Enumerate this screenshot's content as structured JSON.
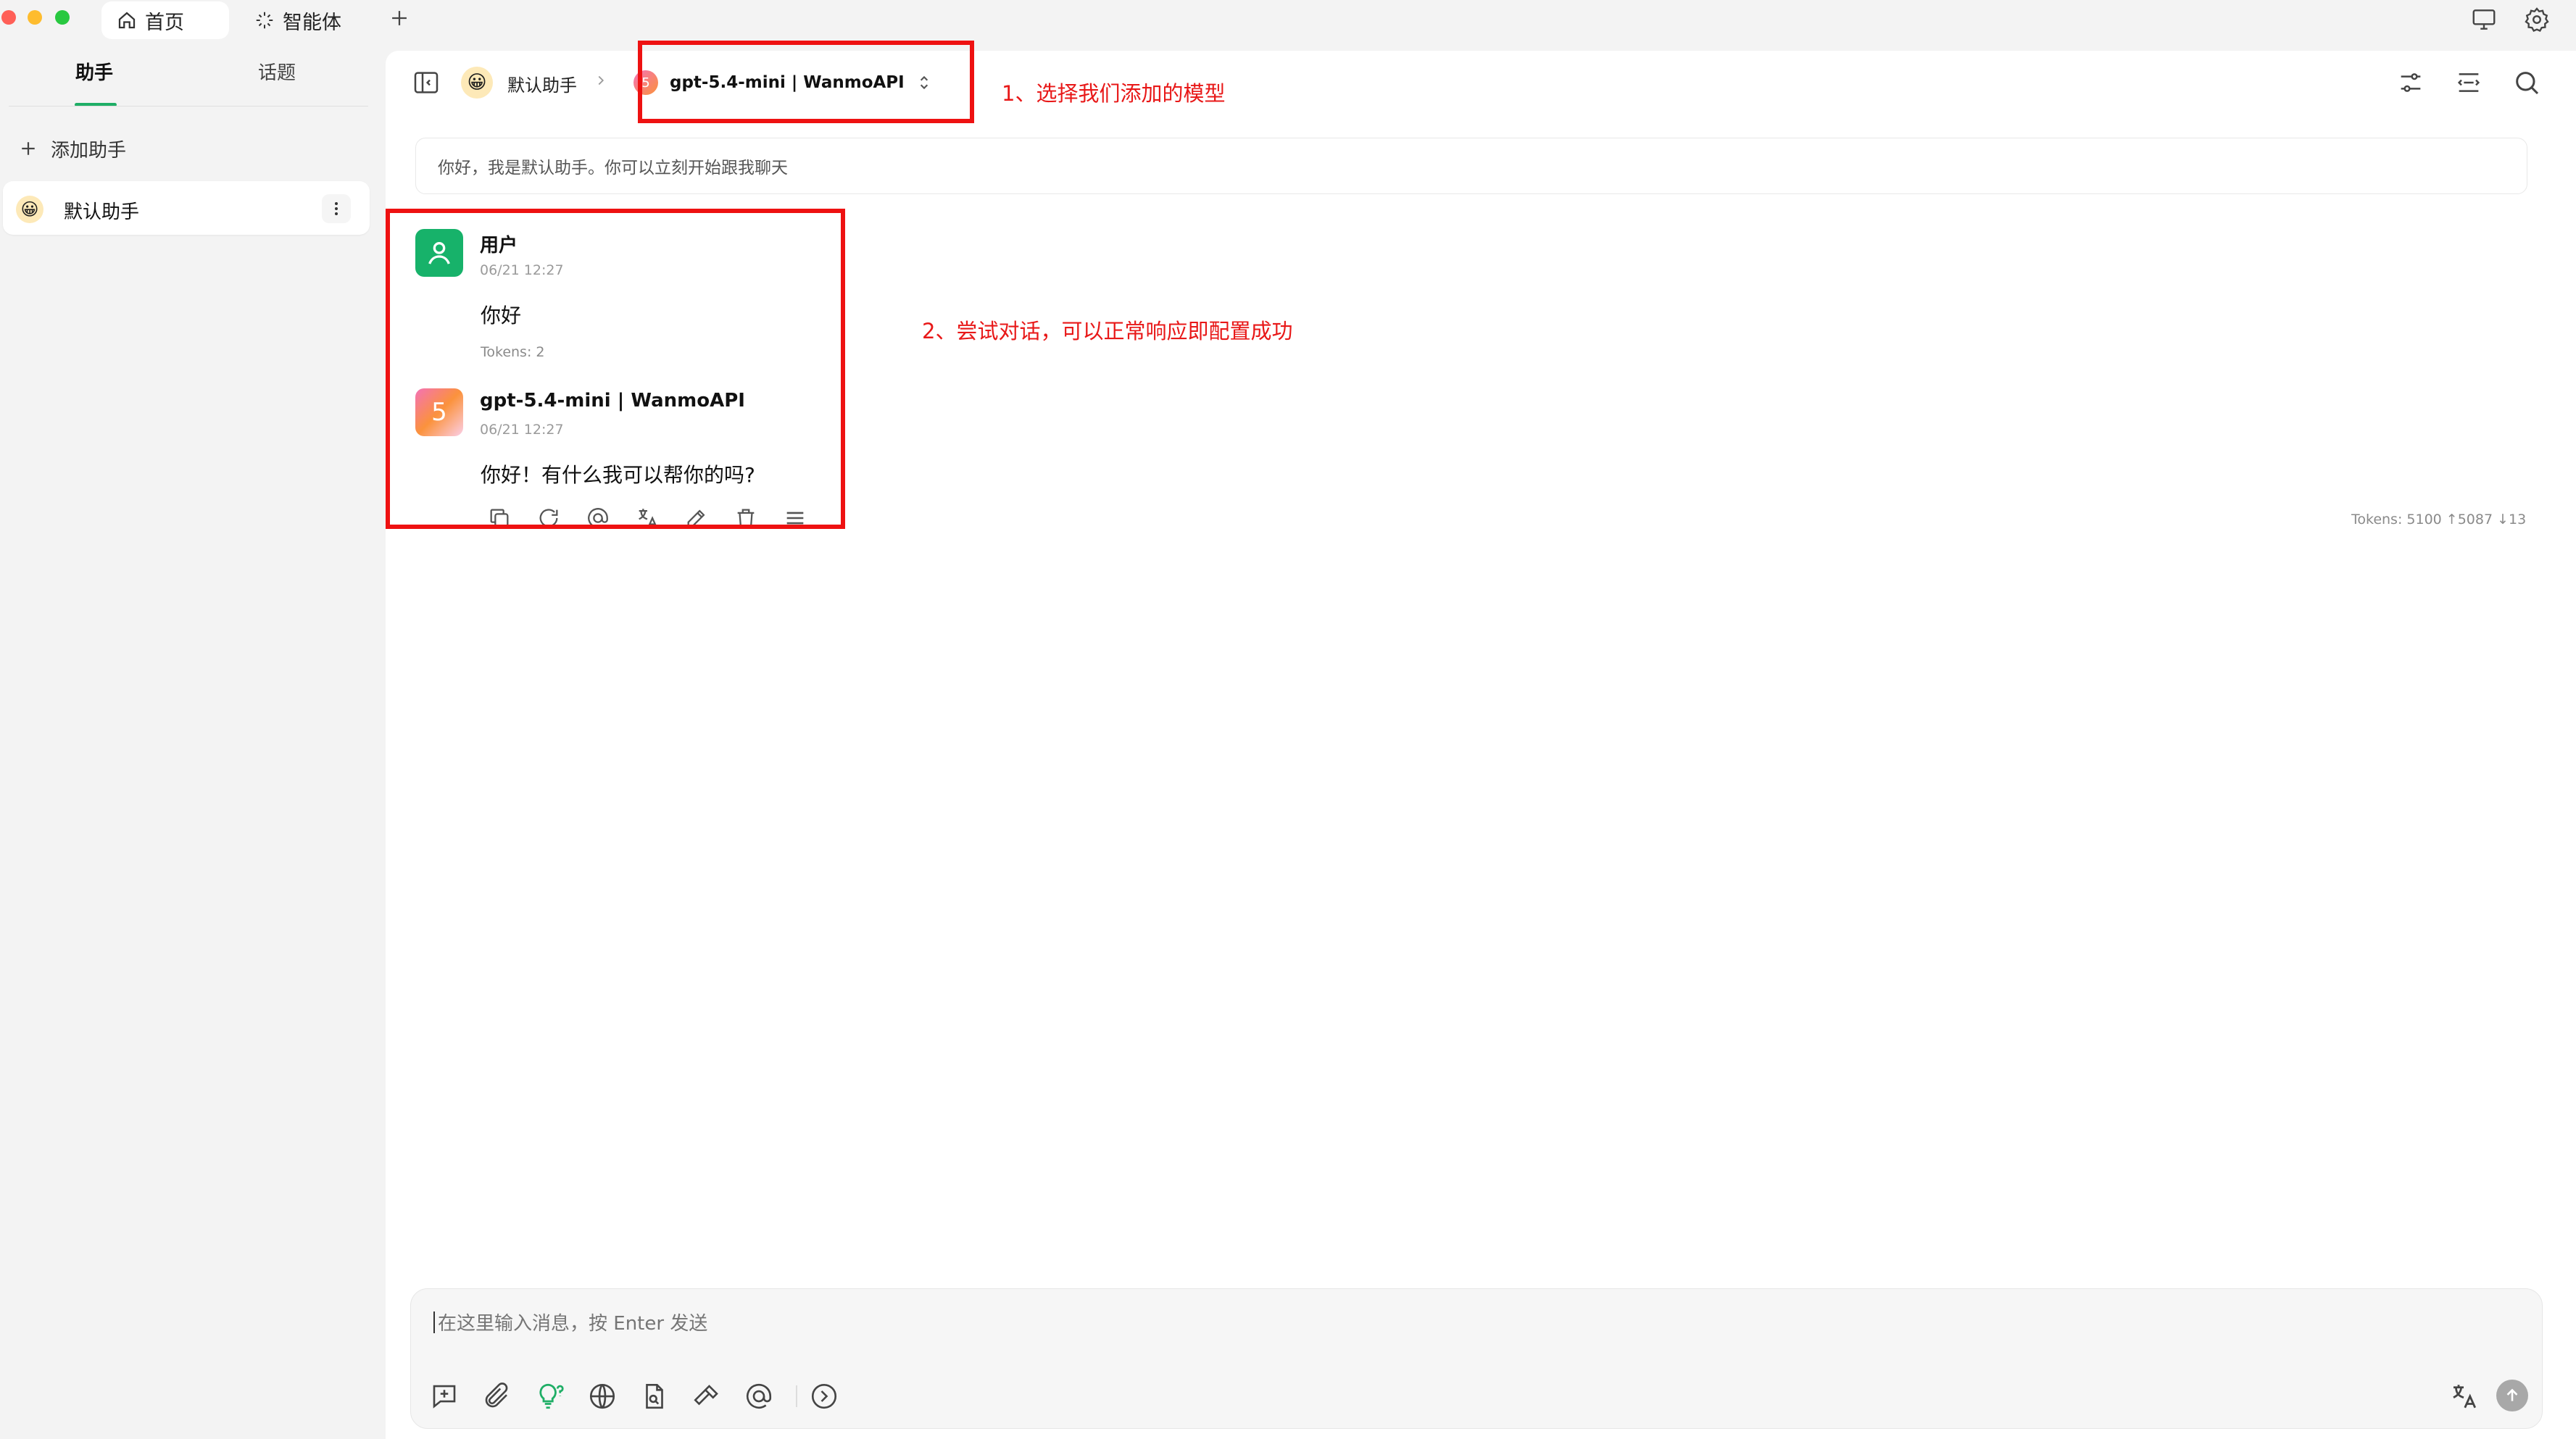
{
  "titlebar": {
    "tabs": [
      {
        "label": "首页",
        "icon": "home-icon"
      },
      {
        "label": "智能体",
        "icon": "sparkle-icon"
      }
    ],
    "traffic_colors": [
      "#ff5f57",
      "#febc2e",
      "#28c840"
    ]
  },
  "sidebar": {
    "tabs": [
      "助手",
      "话题"
    ],
    "add_label": "添加助手",
    "assistant": {
      "name": "默认助手",
      "emoji": "😀"
    }
  },
  "header": {
    "assistant_name": "默认助手",
    "model_name": "gpt-5.4-mini | WanmoAPI",
    "model_badge": "5"
  },
  "welcome": {
    "text": "你好，我是默认助手。你可以立刻开始跟我聊天"
  },
  "messages": [
    {
      "sender": "用户",
      "time": "06/21 12:27",
      "text": "你好",
      "tokens": "Tokens: 2"
    },
    {
      "sender": "gpt-5.4-mini | WanmoAPI",
      "badge": "5",
      "time": "06/21 12:27",
      "text": "你好！有什么我可以帮你的吗?",
      "tokens": "Tokens: 5100 ↑5087 ↓13"
    }
  ],
  "annotations": {
    "step1": "1、选择我们添加的模型",
    "step2": "2、尝试对话，可以正常响应即配置成功"
  },
  "input": {
    "placeholder": "在这里输入消息，按 Enter 发送"
  },
  "colors": {
    "accent_green": "#1fae66",
    "annotation_red": "#ee1111",
    "user_avatar": "#17b26a"
  }
}
